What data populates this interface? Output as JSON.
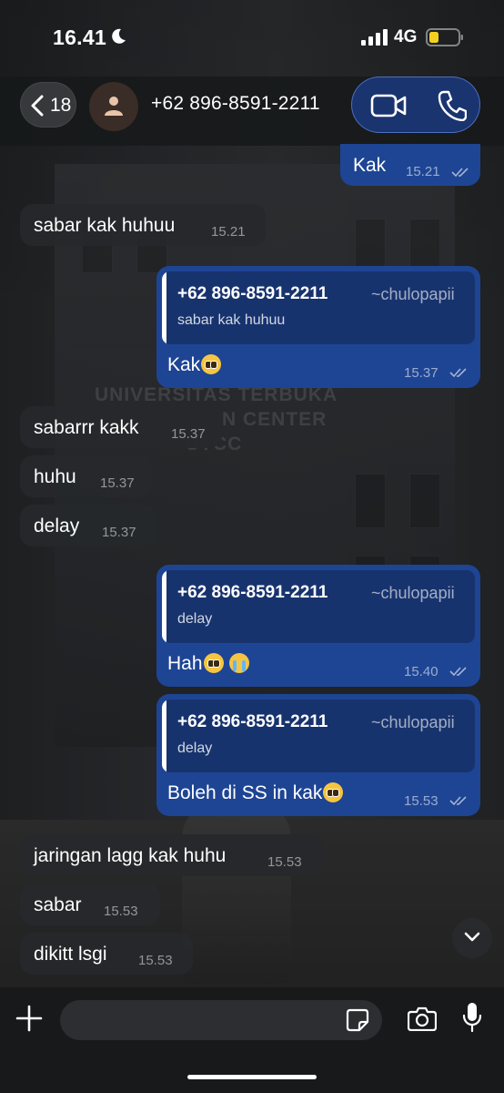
{
  "status_bar": {
    "time": "16.41",
    "network": "4G"
  },
  "header": {
    "back_count": "18",
    "contact_name": "+62 896-8591-2211"
  },
  "wallpaper_text": [
    "UNIVERSITAS TERBUKA",
    "N CENTER",
    "UTCC"
  ],
  "messages": [
    {
      "dir": "out",
      "text": "Kak",
      "time": "15.21"
    },
    {
      "dir": "in",
      "text": "sabar kak huhuu",
      "time": "15.21"
    },
    {
      "dir": "out",
      "quote_name": "+62 896-8591-2211",
      "quote_handle": "~chulopapii",
      "quote_text": "sabar kak huhuu",
      "text": "Kak",
      "time": "15.37"
    },
    {
      "dir": "in",
      "text": "sabarrr kakk",
      "time": "15.37"
    },
    {
      "dir": "in",
      "text": "huhu",
      "time": "15.37"
    },
    {
      "dir": "in",
      "text": "delay",
      "time": "15.37"
    },
    {
      "dir": "out",
      "quote_name": "+62 896-8591-2211",
      "quote_handle": "~chulopapii",
      "quote_text": "delay",
      "text": "Hah",
      "time": "15.40"
    },
    {
      "dir": "out",
      "quote_name": "+62 896-8591-2211",
      "quote_handle": "~chulopapii",
      "quote_text": "delay",
      "text": "Boleh di SS in kak",
      "time": "15.53"
    },
    {
      "dir": "in",
      "text": "jaringan lagg kak huhu",
      "time": "15.53"
    },
    {
      "dir": "in",
      "text": "sabar",
      "time": "15.53"
    },
    {
      "dir": "in",
      "text": "dikitt lsgi",
      "time": "15.53"
    }
  ],
  "input": {
    "placeholder": ""
  },
  "colors": {
    "outgoing": "#1e4594",
    "incoming": "#26282b",
    "accent": "#1a3470"
  },
  "icons": [
    "moon-icon",
    "signal-icon",
    "battery-icon",
    "back-chevron-icon",
    "avatar-person-icon",
    "video-call-icon",
    "phone-call-icon",
    "double-check-icon",
    "chevron-down-icon",
    "plus-icon",
    "sticker-icon",
    "camera-icon",
    "mic-icon"
  ]
}
